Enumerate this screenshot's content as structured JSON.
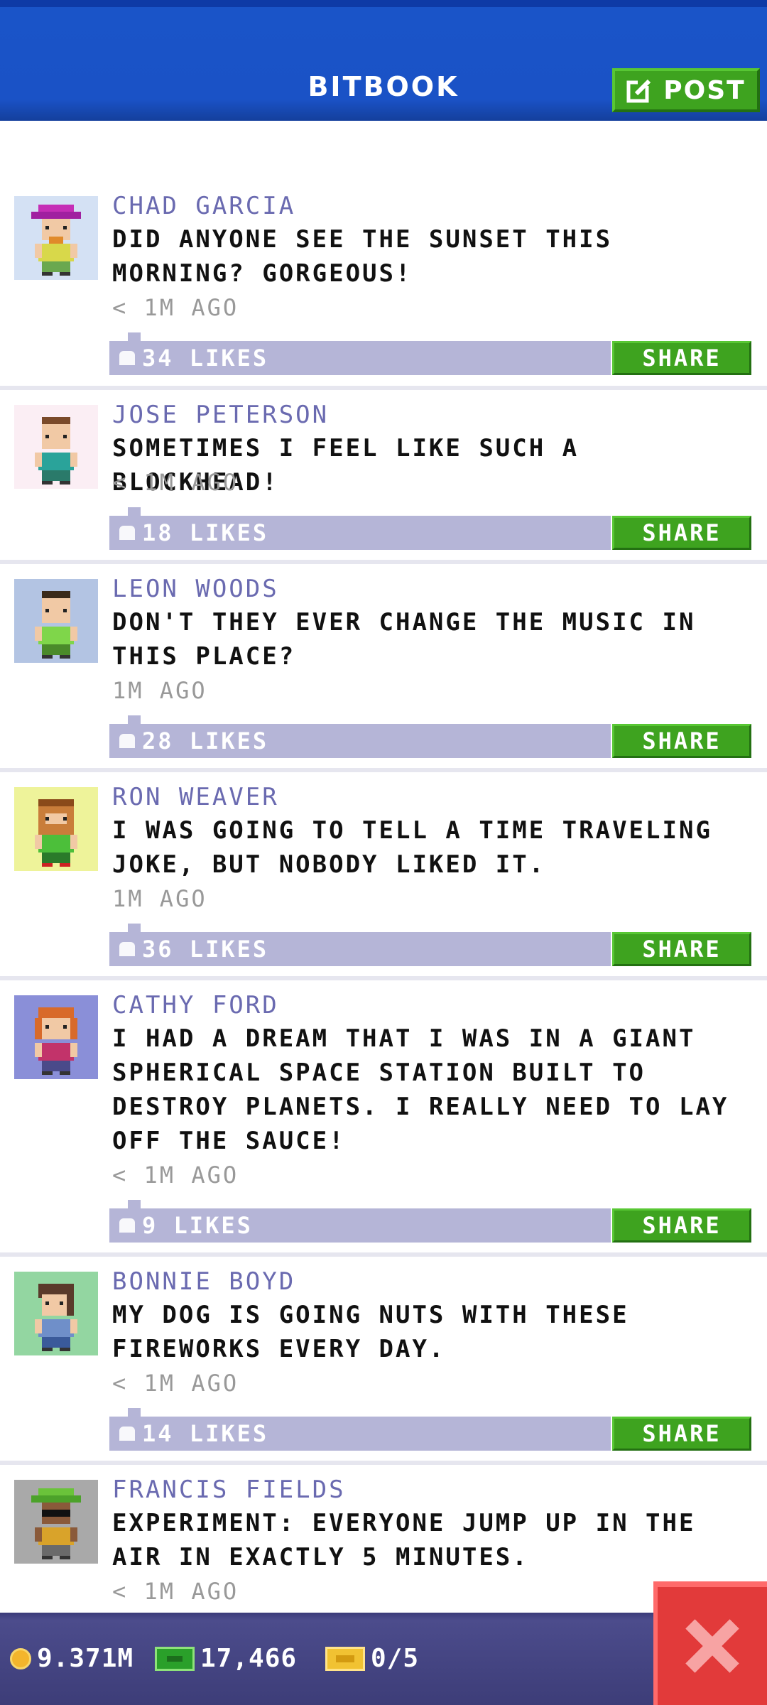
{
  "header": {
    "title": "BITBOOK",
    "post_label": "POST"
  },
  "posts": [
    {
      "name": "CHAD GARCIA",
      "message": "DID ANYONE SEE THE SUNSET THIS MORNING? GORGEOUS!",
      "time": "< 1M AGO",
      "likes": "34 LIKES",
      "share": "SHARE"
    },
    {
      "name": "JOSE PETERSON",
      "message": "SOMETIMES I FEEL LIKE SUCH A BLOCKHEAD!",
      "time": "< 1M AGO",
      "likes": "18 LIKES",
      "share": "SHARE"
    },
    {
      "name": "LEON WOODS",
      "message": "DON'T THEY EVER CHANGE THE MUSIC IN THIS PLACE?",
      "time": "1M AGO",
      "likes": "28 LIKES",
      "share": "SHARE"
    },
    {
      "name": "RON WEAVER",
      "message": "I WAS GOING TO TELL A TIME TRAVELING JOKE, BUT NOBODY LIKED IT.",
      "time": "1M AGO",
      "likes": "36 LIKES",
      "share": "SHARE"
    },
    {
      "name": "CATHY FORD",
      "message": "I HAD A DREAM THAT I WAS IN A GIANT SPHERICAL SPACE STATION BUILT TO DESTROY PLANETS. I REALLY NEED TO LAY OFF THE SAUCE!",
      "time": "< 1M AGO",
      "likes": "9 LIKES",
      "share": "SHARE"
    },
    {
      "name": "BONNIE BOYD",
      "message": "MY DOG IS GOING NUTS WITH THESE FIREWORKS EVERY DAY.",
      "time": "< 1M AGO",
      "likes": "14 LIKES",
      "share": "SHARE"
    },
    {
      "name": "FRANCIS FIELDS",
      "message": "EXPERIMENT: EVERYONE JUMP UP IN THE AIR IN EXACTLY 5 MINUTES.",
      "time": "< 1M AGO",
      "likes": "",
      "share": ""
    }
  ],
  "footer": {
    "coins": "9.371M",
    "bux": "17,466",
    "tickets": "0/5"
  },
  "colors": {
    "header_blue": "#1a52c6",
    "name_purple": "#6a6ab0",
    "like_bar": "#b5b5d7",
    "share_green": "#3ea31f",
    "close_red": "#e23a3a",
    "footer_navy": "#3d3d78"
  },
  "icons": [
    "edit-icon",
    "like-icon",
    "coin-icon",
    "bux-icon",
    "ticket-icon",
    "close-icon"
  ]
}
